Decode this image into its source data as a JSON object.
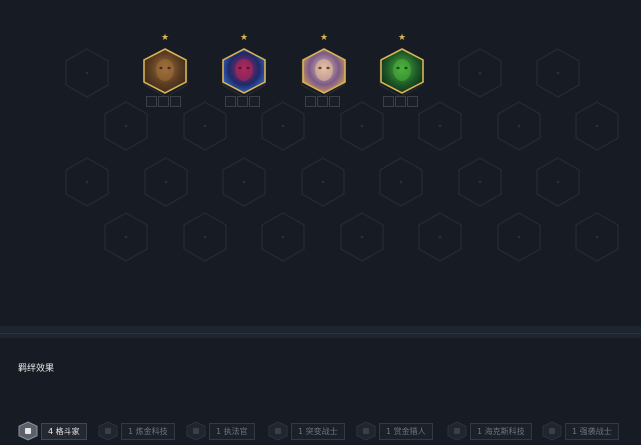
{
  "board": {
    "rows": [
      {
        "offset": "a",
        "count": 7
      },
      {
        "offset": "b",
        "count": 7
      },
      {
        "offset": "a",
        "count": 7
      },
      {
        "offset": "b",
        "count": 7
      }
    ],
    "champions": [
      {
        "name": "champion-portrait-1",
        "stars": "★",
        "colors": [
          "#5a3c22",
          "#a0703a",
          "#3a2a18"
        ]
      },
      {
        "name": "champion-portrait-2",
        "stars": "★",
        "colors": [
          "#1d2a6b",
          "#b4265a",
          "#3a6ccb"
        ]
      },
      {
        "name": "champion-portrait-3",
        "stars": "★",
        "colors": [
          "#7a5a8a",
          "#e8c0a0",
          "#d7a050"
        ]
      },
      {
        "name": "champion-portrait-4",
        "stars": "★",
        "colors": [
          "#1e5a28",
          "#4cb23a",
          "#0f2a12"
        ]
      }
    ]
  },
  "synergy": {
    "title": "羁绊效果",
    "traits": [
      {
        "label": "4 格斗家",
        "active": true,
        "icon": "brawler-icon"
      },
      {
        "label": "1 炼金科技",
        "active": false,
        "icon": "chemtech-icon"
      },
      {
        "label": "1 执法官",
        "active": false,
        "icon": "enforcer-icon"
      },
      {
        "label": "1 突变战士",
        "active": false,
        "icon": "mutant-icon"
      },
      {
        "label": "1 赏金猎人",
        "active": false,
        "icon": "mercenary-icon"
      },
      {
        "label": "1 海克斯科技",
        "active": false,
        "icon": "hextech-icon"
      },
      {
        "label": "1 强袭战士",
        "active": false,
        "icon": "bruiser-icon"
      }
    ]
  },
  "colors": {
    "background": "#171b23",
    "slot_stroke": "#262b35",
    "star": "#d8b358",
    "active_trait": "#e9e9e9",
    "inactive_trait": "#6f7683"
  }
}
